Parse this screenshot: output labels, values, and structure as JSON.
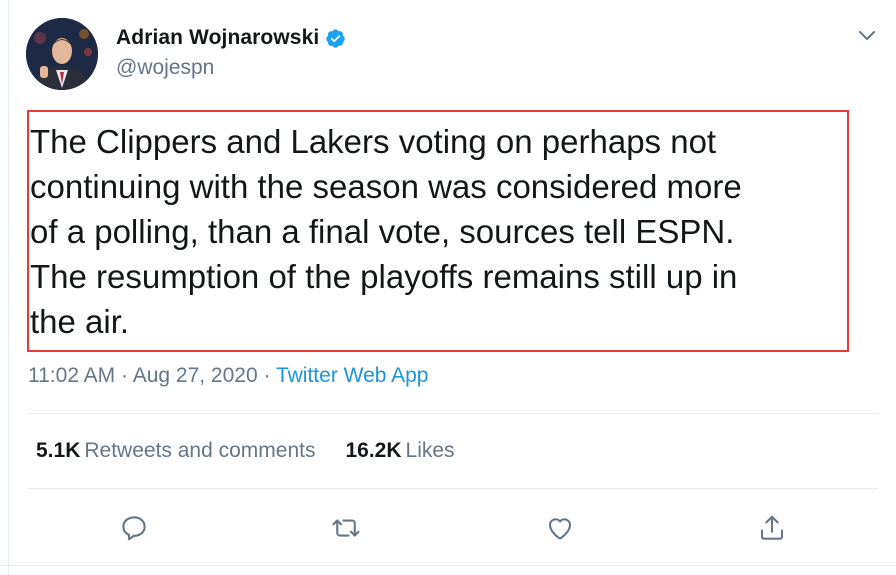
{
  "tweet": {
    "author_name": "Adrian Wojnarowski",
    "author_handle": "@wojespn",
    "text": "The Clippers and Lakers voting on perhaps not\ncontinuing with the season was considered more\nof a polling, than a final vote, sources tell ESPN.\nThe resumption of the playoffs remains still up in\nthe air.",
    "time": "11:02 AM",
    "date": "Aug 27, 2020",
    "separator": "·",
    "source_app": "Twitter Web App",
    "stats": {
      "retweets_count": "5.1K",
      "retweets_label": "Retweets and comments",
      "likes_count": "16.2K",
      "likes_label": "Likes"
    }
  },
  "icons": {
    "verified": "verified-badge-icon",
    "more": "chevron-down-icon",
    "reply": "reply-icon",
    "retweet": "retweet-icon",
    "like": "heart-icon",
    "share": "share-icon"
  },
  "colors": {
    "accent": "#1b95e0",
    "verified": "#1da1f2",
    "secondary_text": "#657786",
    "highlight_border": "#e8393b"
  }
}
